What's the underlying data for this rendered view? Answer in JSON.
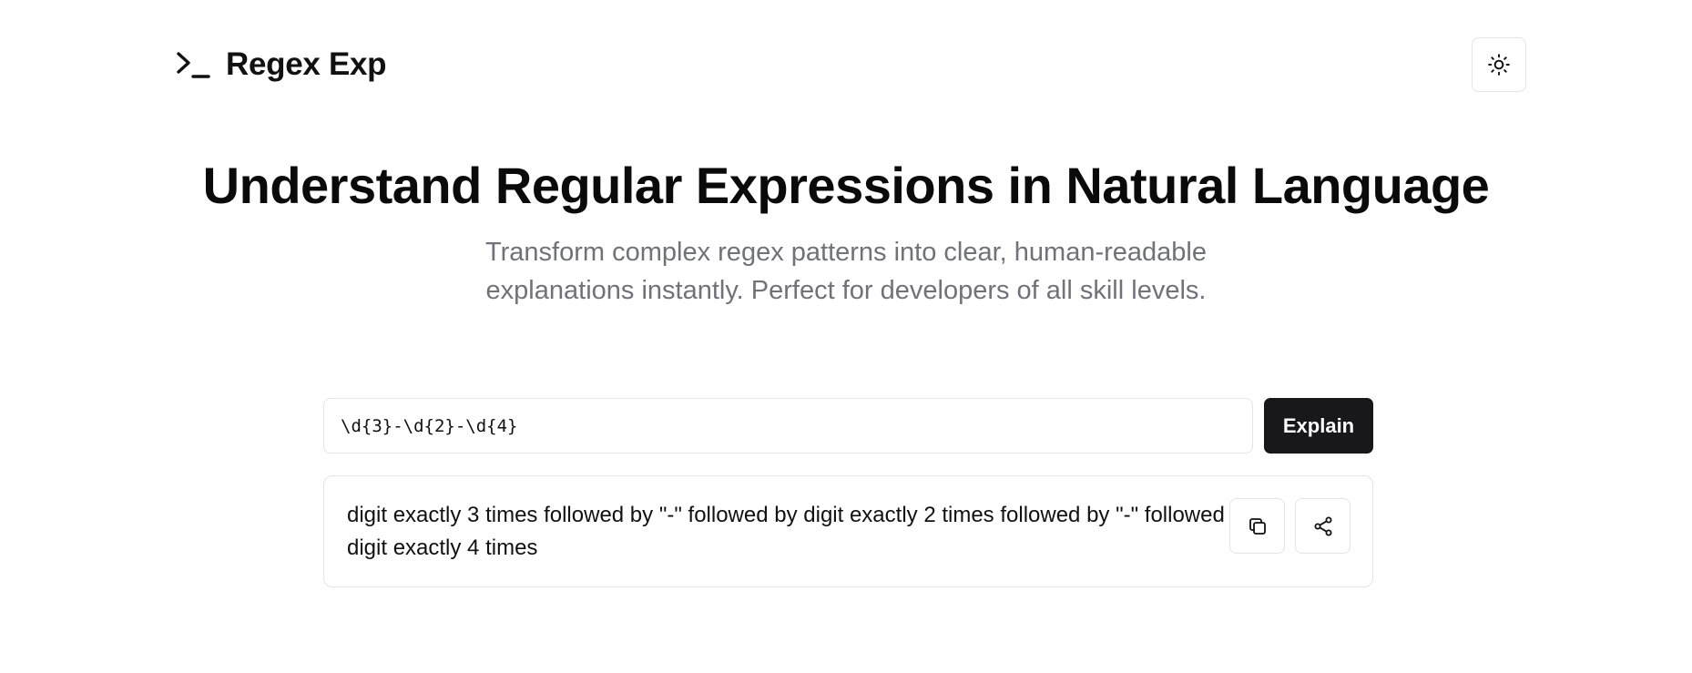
{
  "header": {
    "logo_text": "Regex Exp",
    "logo_icon": "terminal-prompt-icon",
    "theme_toggle_icon": "sun-icon"
  },
  "hero": {
    "title": "Understand Regular Expressions in Natural Language",
    "subtitle": "Transform complex regex patterns into clear, human-readable explanations instantly. Perfect for developers of all skill levels."
  },
  "form": {
    "regex_value": "\\d{3}-\\d{2}-\\d{4}",
    "explain_label": "Explain"
  },
  "result": {
    "explanation": "digit exactly 3 times followed by \"-\" followed by digit exactly 2 times followed by \"-\" followed by digit exactly 4 times",
    "copy_icon": "copy-icon",
    "share_icon": "share-icon"
  },
  "colors": {
    "text": "#111111",
    "muted": "#71717a",
    "border": "#e4e4e7",
    "button_bg": "#18181b"
  }
}
